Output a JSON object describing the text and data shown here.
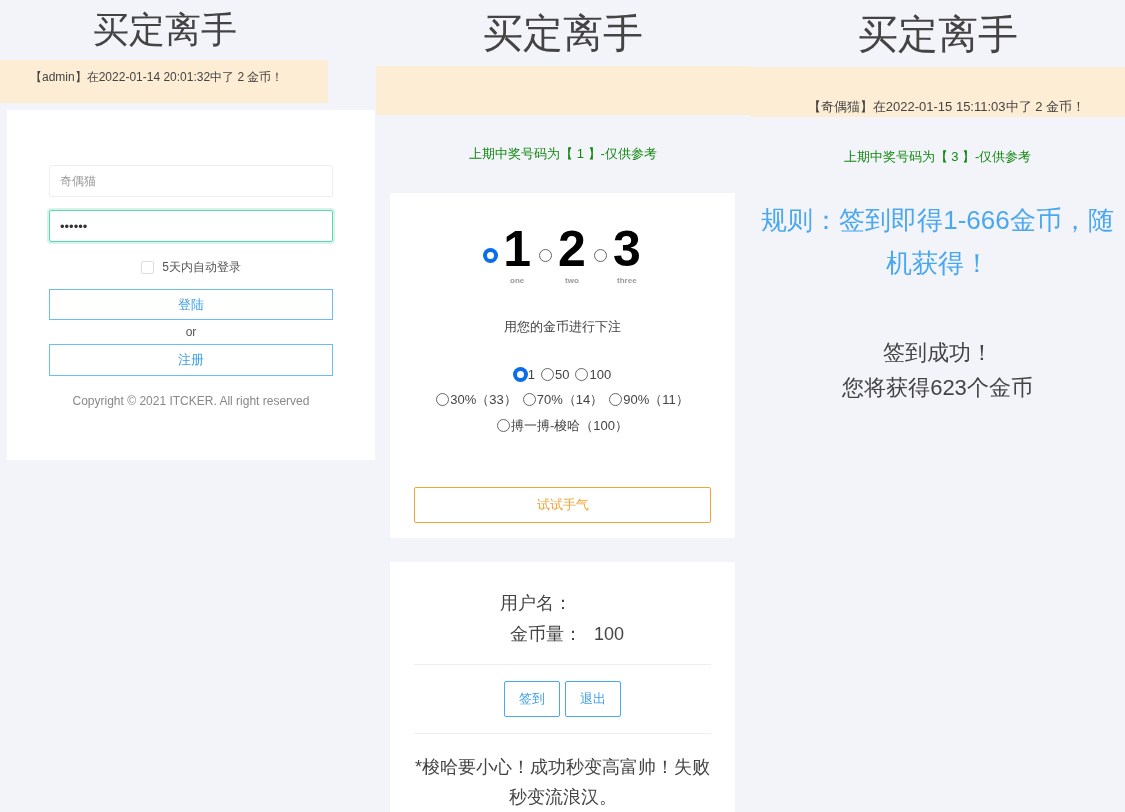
{
  "left": {
    "title": "买定离手",
    "ticker": "【admin】在2022-01-14 20:01:32中了 2 金币！",
    "login": {
      "username": {
        "placeholder": "奇偶猫"
      },
      "password": {
        "value": "••••••",
        "focused": true
      },
      "remember": {
        "label": "5天内自动登录",
        "checked": false
      },
      "login_button": "登陆",
      "or": "or",
      "register_button": "注册",
      "copyright": "Copyright © 2021 ITCKER. All right reserved"
    }
  },
  "middle": {
    "title": "买定离手",
    "last_number": "上期中奖号码为【 1 】-仅供参考",
    "numbers": [
      {
        "digit": "1",
        "caption": "one",
        "selected": true
      },
      {
        "digit": "2",
        "caption": "two",
        "selected": false
      },
      {
        "digit": "3",
        "caption": "three",
        "selected": false
      }
    ],
    "bet_prompt": "用您的金币进行下注",
    "option_rows": [
      [
        {
          "label": "1",
          "selected": true
        },
        {
          "label": "50",
          "selected": false
        },
        {
          "label": "100",
          "selected": false
        }
      ],
      [
        {
          "label": "30%（33）",
          "selected": false
        },
        {
          "label": "70%（14）",
          "selected": false
        },
        {
          "label": "90%（11）",
          "selected": false
        }
      ],
      [
        {
          "label": "搏一搏-梭哈（100）",
          "selected": false
        }
      ]
    ],
    "try_button": "试试手气",
    "user": {
      "username_label": "用户名：",
      "coins_label": "金币量：",
      "coins": "100"
    },
    "buttons": [
      "签到",
      "退出"
    ],
    "warning": "*梭哈要小心！成功秒变高富帅！失败秒变流浪汉。"
  },
  "right": {
    "title": "买定离手",
    "ticker": "【奇偶猫】在2022-01-15 15:11:03中了 2 金币！",
    "last_number": "上期中奖号码为【 3 】-仅供参考",
    "rule": "规则：签到即得1-666金币，随机获得！",
    "result": [
      "签到成功！",
      "您将获得623个金币"
    ]
  }
}
